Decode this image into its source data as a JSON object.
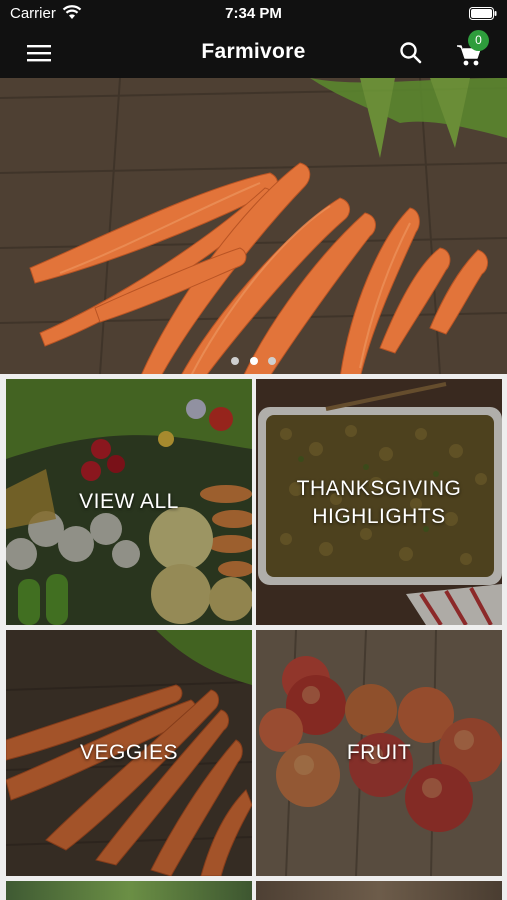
{
  "status": {
    "carrier": "Carrier",
    "time": "7:34 PM"
  },
  "nav": {
    "title": "Farmivore",
    "cart_count": "0"
  },
  "hero": {
    "slide_count": 3,
    "active_slide": 1
  },
  "categories": [
    {
      "label": "VIEW ALL"
    },
    {
      "label": "THANKSGIVING HIGHLIGHTS",
      "line1": "THANKSGIVING",
      "line2": "HIGHLIGHTS"
    },
    {
      "label": "VEGGIES"
    },
    {
      "label": "FRUIT"
    }
  ],
  "colors": {
    "bar": "#111111",
    "badge": "#2e9d3c",
    "carrot": "#e2743a"
  },
  "icons": [
    "wifi-icon",
    "battery-icon",
    "menu-icon",
    "search-icon",
    "cart-icon"
  ]
}
